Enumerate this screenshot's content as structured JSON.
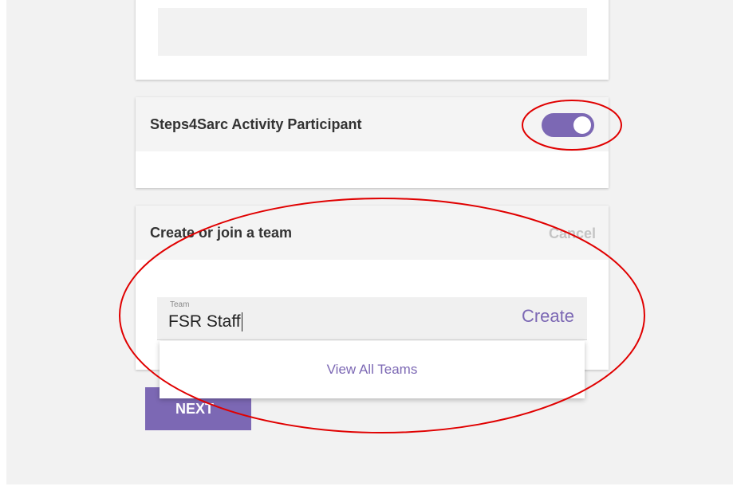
{
  "colors": {
    "accent": "#7c68b4",
    "annotation": "#e00000"
  },
  "participant_card": {
    "title": "Steps4Sarc Activity Participant",
    "toggle_on": true
  },
  "team_card": {
    "title": "Create or join a team",
    "cancel_label": "Cancel",
    "team_input": {
      "label": "Team",
      "value": "FSR Staff"
    },
    "create_label": "Create",
    "dropdown": {
      "items": [
        "View All Teams"
      ]
    }
  },
  "next_button_label": "NEXT"
}
